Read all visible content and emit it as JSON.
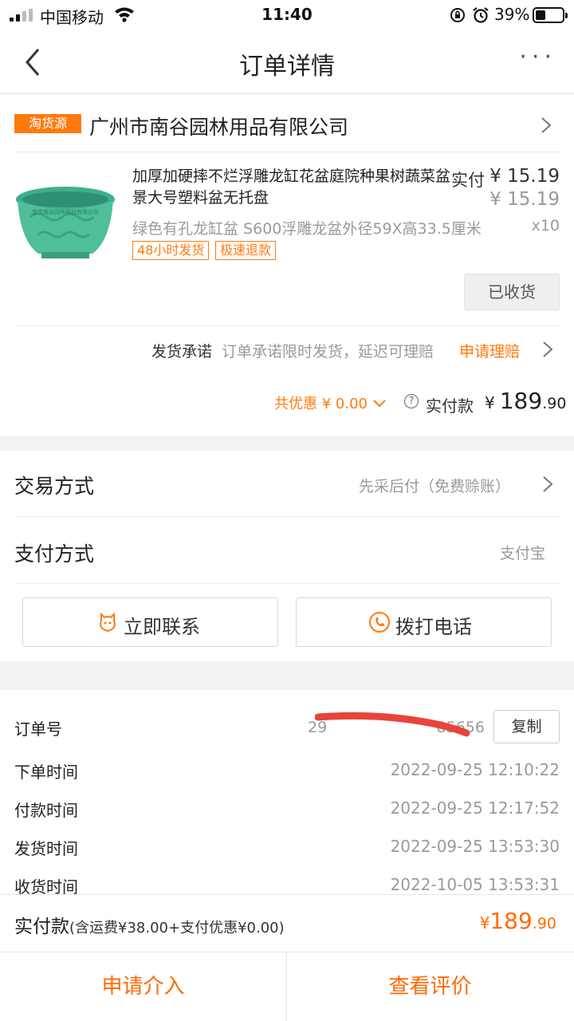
{
  "status_bar": {
    "carrier": "中国移动",
    "time": "11:40",
    "battery_pct": "39%",
    "battery_level": 0.39
  },
  "nav": {
    "title": "订单详情",
    "more": "···"
  },
  "shop": {
    "tag": "淘货源",
    "name": "广州市南谷园林用品有限公司"
  },
  "product": {
    "title": "加厚加硬摔不烂浮雕龙缸花盆庭院种果树蔬菜盆景大号塑料盆无托盘",
    "paid_label": "实付",
    "paid_price": "¥ 15.19",
    "original_price": "¥ 15.19",
    "spec": "绿色有孔龙缸盆 S600浮雕龙盆外径59X高33.5厘米",
    "quantity": "x10",
    "badges": [
      "48小时发货",
      "极速退款"
    ],
    "image_watermark": "南市南谷园林用品有限公司",
    "status_button": "已收货"
  },
  "promise": {
    "label": "发货承诺",
    "text": "订单承诺限时发货，延迟可理赔",
    "link": "申请理赔"
  },
  "totals": {
    "discount": "共优惠 ¥ 0.00",
    "paid_label": "实付款",
    "currency": "¥",
    "paid_int": "189",
    "paid_dec": ".90"
  },
  "trade": {
    "label": "交易方式",
    "value": "先采后付（免费赊账）"
  },
  "payment": {
    "label": "支付方式",
    "value": "支付宝"
  },
  "actions": {
    "contact": "立即联系",
    "call": "拨打电话"
  },
  "order_info": {
    "order_no_label": "订单号",
    "order_no_visible": "29",
    "order_no_visible_end": "85656",
    "copy": "复制",
    "rows": [
      {
        "label": "下单时间",
        "value": "2022-09-25 12:10:22"
      },
      {
        "label": "付款时间",
        "value": "2022-09-25 12:17:52"
      },
      {
        "label": "发货时间",
        "value": "2022-09-25 13:53:30"
      },
      {
        "label": "收货时间",
        "value": "2022-10-05 13:53:31"
      }
    ]
  },
  "summary": {
    "label": "实付款",
    "sub": "(含运费¥38.00+支付优惠¥0.00)",
    "currency": "¥",
    "amount_int": "189",
    "amount_dec": ".90"
  },
  "bottom": {
    "intervene": "申请介入",
    "review": "查看评价"
  },
  "colors": {
    "accent": "#ff7a0d",
    "price": "#ff6a00"
  }
}
